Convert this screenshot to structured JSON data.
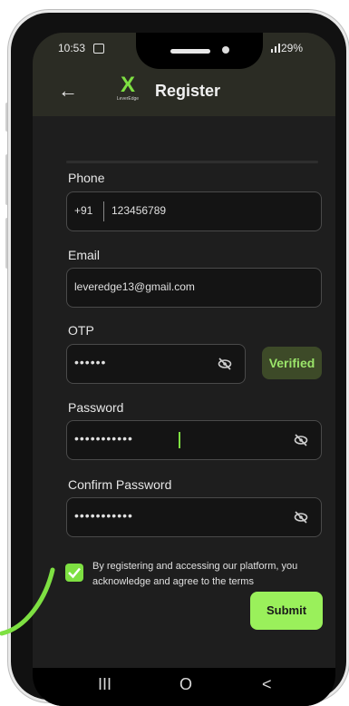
{
  "status_bar": {
    "time": "10:53",
    "battery": "29%"
  },
  "app_bar": {
    "back_icon": "arrow-left-icon",
    "logo_mark": "X",
    "logo_subtext": "LeverEdge",
    "title": "Register"
  },
  "form": {
    "phone": {
      "label": "Phone",
      "country_code": "+91",
      "value": "123456789"
    },
    "email": {
      "label": "Email",
      "value": "leveredge13@gmail.com"
    },
    "otp": {
      "label": "OTP",
      "masked_value": "••••••",
      "status": "Verified"
    },
    "password": {
      "label": "Password",
      "masked_value": "•••••••••••"
    },
    "confirm_password": {
      "label": "Confirm Password",
      "masked_value": "•••••••••••"
    },
    "consent_text": "By registering and accessing our platform, you acknowledge and agree to the terms",
    "submit_label": "Submit"
  },
  "nav_bar": {
    "recents": "III",
    "home": "O",
    "back": "<"
  },
  "colors": {
    "accent": "#9af05b",
    "background": "#1e1e1e",
    "app_bar": "#2b2c24"
  }
}
